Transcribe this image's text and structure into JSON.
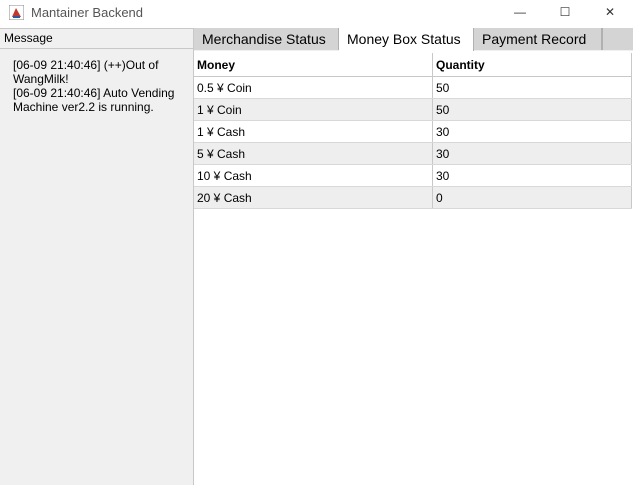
{
  "window": {
    "title": "Mantainer Backend"
  },
  "controls": {
    "minimize": "—",
    "maximize": "☐",
    "close": "✕"
  },
  "message_panel": {
    "header": "Message",
    "text": "[06-09 21:40:46] (++)Out of WangMilk!\n[06-09 21:40:46] Auto Vending Machine ver2.2 is running."
  },
  "tabs": [
    {
      "label": "Merchandise Status",
      "selected": false
    },
    {
      "label": "Money Box Status",
      "selected": true
    },
    {
      "label": "Payment Record",
      "selected": false
    }
  ],
  "table": {
    "columns": [
      "Money",
      "Quantity"
    ],
    "rows": [
      [
        "0.5 ¥ Coin",
        "50"
      ],
      [
        "1 ¥ Coin",
        "50"
      ],
      [
        "1 ¥ Cash",
        "30"
      ],
      [
        "5 ¥ Cash",
        "30"
      ],
      [
        "10 ¥ Cash",
        "30"
      ],
      [
        "20 ¥ Cash",
        "0"
      ]
    ]
  },
  "colors": {
    "icon_red": "#c0392b",
    "tab_bg": "#d4d4d4",
    "alt_row": "#eeeeee"
  },
  "icons": {
    "app": "java-cup-icon"
  }
}
